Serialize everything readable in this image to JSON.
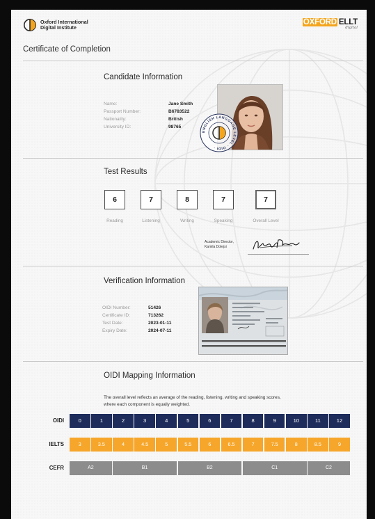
{
  "header": {
    "org_line1": "Oxford International",
    "org_line2": "Digital Institute",
    "brand_part1": "OXFORD",
    "brand_part2": "ELLT",
    "brand_sub": "digital"
  },
  "title": "Certificate of Completion",
  "candidate": {
    "heading": "Candidate Information",
    "fields": [
      {
        "label": "Name:",
        "value": "Jane Smith"
      },
      {
        "label": "Passport Number:",
        "value": "B6783522"
      },
      {
        "label": "Nationality:",
        "value": "British"
      },
      {
        "label": "University ID:",
        "value": "98765"
      }
    ],
    "seal_text": "ENGLISH LANGUAGE LEVEL · OIDI ·"
  },
  "results": {
    "heading": "Test Results",
    "scores": [
      {
        "label": "Reading",
        "value": "6"
      },
      {
        "label": "Listening",
        "value": "7"
      },
      {
        "label": "Writing",
        "value": "8"
      },
      {
        "label": "Speaking",
        "value": "7"
      },
      {
        "label": "Overall Level",
        "value": "7"
      }
    ],
    "signer_title": "Academic Director,",
    "signer_name": "Kamila Dolejsi"
  },
  "verification": {
    "heading": "Verification Information",
    "fields": [
      {
        "label": "OIDI Number:",
        "value": "51426"
      },
      {
        "label": "Certificate ID:",
        "value": "713262"
      },
      {
        "label": "Test Date:",
        "value": "2023-01-11"
      },
      {
        "label": "Expiry Date:",
        "value": "2024-07-11"
      }
    ]
  },
  "mapping": {
    "heading": "OIDI Mapping Information",
    "description": "The overall level reflects an average of the reading, listening, writing and speaking scores, where each component is equally weighted.",
    "row_labels": {
      "oidi": "OIDI",
      "ielts": "IELTS",
      "cefr": "CEFR"
    },
    "oidi": [
      "0",
      "1",
      "2",
      "3",
      "4",
      "5",
      "6",
      "7",
      "8",
      "9",
      "10",
      "11",
      "12"
    ],
    "ielts": [
      "3",
      "3.5",
      "4",
      "4.5",
      "5",
      "5.5",
      "6",
      "6.5",
      "7",
      "7.5",
      "8",
      "8.5",
      "9"
    ],
    "cefr": [
      {
        "label": "A2",
        "span": 2
      },
      {
        "label": "B1",
        "span": 3
      },
      {
        "label": "B2",
        "span": 3
      },
      {
        "label": "C1",
        "span": 3
      },
      {
        "label": "C2",
        "span": 2
      }
    ]
  },
  "colors": {
    "oidi": "#1e2c5b",
    "ielts": "#f6a62a",
    "cefr": "#8c8c8c",
    "brand_orange": "#f3a51e"
  }
}
